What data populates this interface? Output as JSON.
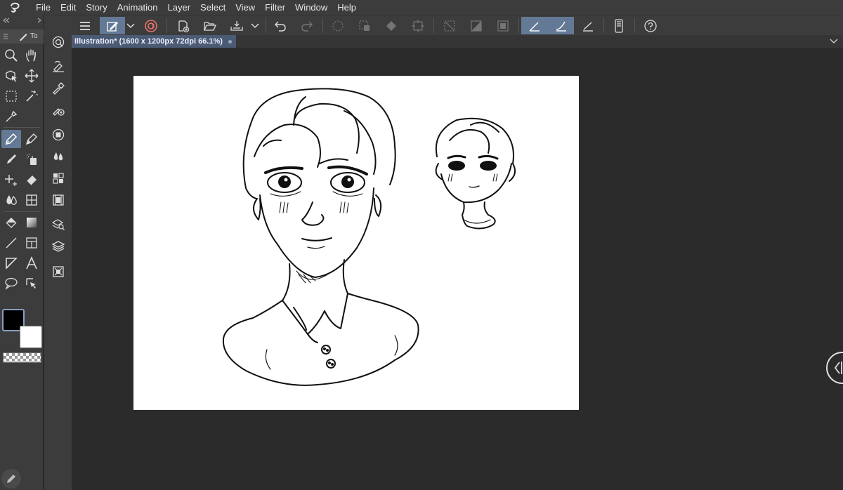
{
  "menubar": {
    "logo_icon": "clip-logo-icon",
    "items": [
      "File",
      "Edit",
      "Story",
      "Animation",
      "Layer",
      "Select",
      "View",
      "Filter",
      "Window",
      "Help"
    ]
  },
  "tool_panel": {
    "tab_label": "To"
  },
  "document": {
    "tab_title": "Illustration* (1600 x 1200px 72dpi 66.1%)"
  },
  "colors": {
    "main": "#000000",
    "sub": "#ffffff",
    "accent": "#647996",
    "ui_bg": "#3c3c3c",
    "workspace_bg": "#2b2b2b"
  }
}
